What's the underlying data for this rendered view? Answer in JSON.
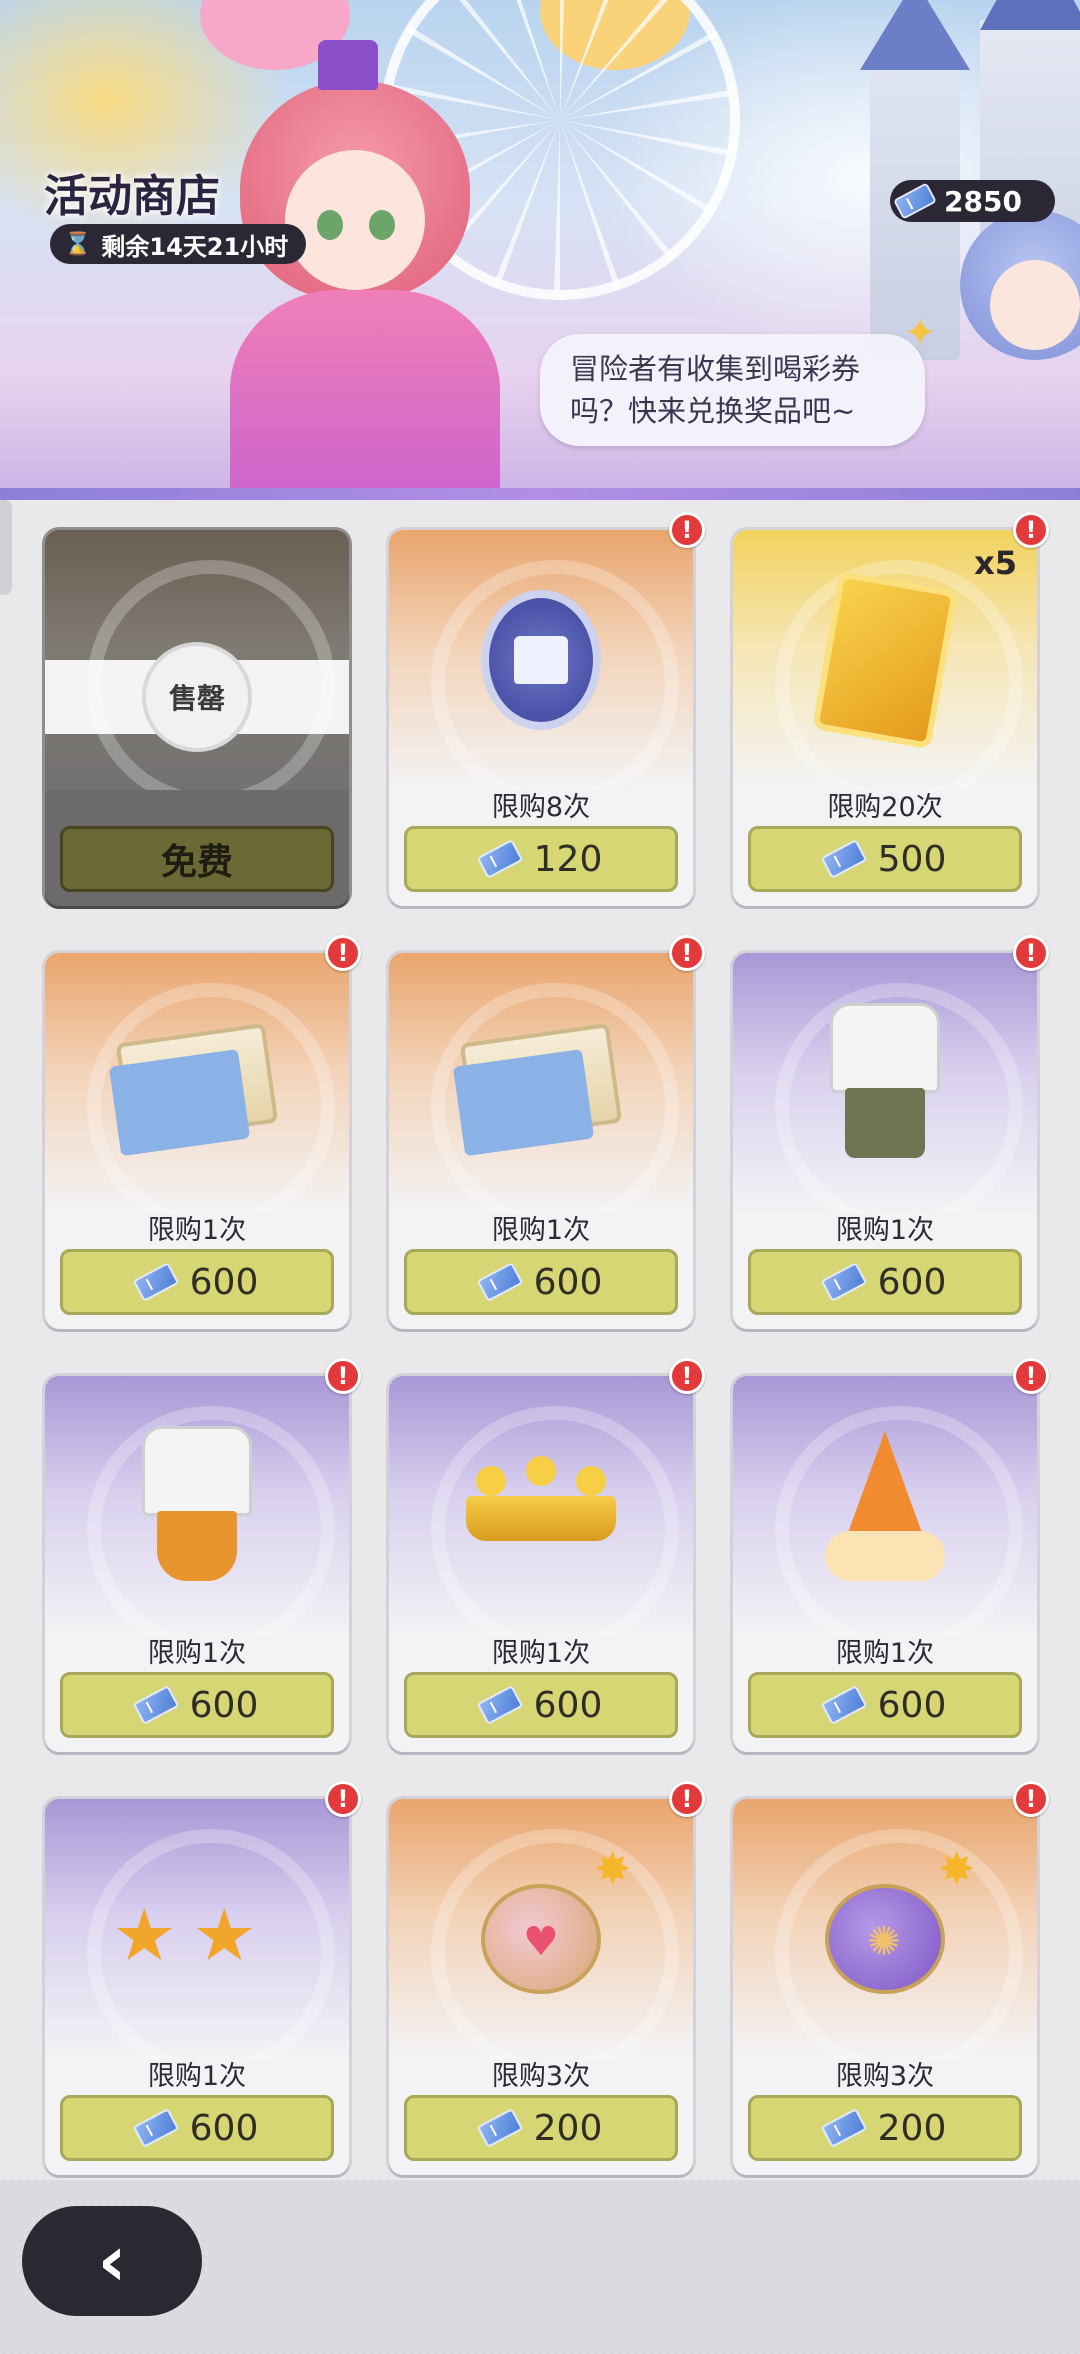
{
  "header": {
    "title": "活动商店",
    "timer_text": "剩余14天21小时",
    "currency_amount": "2850",
    "speech": [
      "冒险者有收集到喝彩券",
      "吗？快来兑换奖品吧~"
    ]
  },
  "items": [
    {
      "type": "sold",
      "sold_label": "售罄",
      "price": "免费"
    },
    {
      "type": "coin",
      "limit": "限购8次",
      "price": "120",
      "badge": "!",
      "color": "orange"
    },
    {
      "type": "gold-card",
      "limit": "限购20次",
      "price": "500",
      "badge": "!",
      "color": "yellow",
      "qty": "x5"
    },
    {
      "type": "scroll",
      "limit": "限购1次",
      "price": "600",
      "badge": "!",
      "color": "orange"
    },
    {
      "type": "scroll",
      "limit": "限购1次",
      "price": "600",
      "badge": "!",
      "color": "orange"
    },
    {
      "type": "outfit",
      "limit": "限购1次",
      "price": "600",
      "badge": "!",
      "color": "purple"
    },
    {
      "type": "outfit-orange",
      "limit": "限购1次",
      "price": "600",
      "badge": "!",
      "color": "purple"
    },
    {
      "type": "crown",
      "limit": "限购1次",
      "price": "600",
      "badge": "!",
      "color": "purple"
    },
    {
      "type": "hat",
      "limit": "限购1次",
      "price": "600",
      "badge": "!",
      "color": "purple"
    },
    {
      "type": "glasses",
      "limit": "限购1次",
      "price": "600",
      "badge": "!",
      "color": "purple"
    },
    {
      "type": "bomb",
      "limit": "限购3次",
      "price": "200",
      "badge": "!",
      "color": "orange"
    },
    {
      "type": "bomb-purple",
      "limit": "限购3次",
      "price": "200",
      "badge": "!",
      "color": "orange"
    }
  ],
  "icons": {
    "ticket": "ticket-icon",
    "hourglass": "hourglass-icon",
    "back": "back-arrow-icon"
  },
  "colors": {
    "badge": "#e23a3a",
    "price_button": "#d6d674",
    "dark_pill": "#2b2734"
  }
}
